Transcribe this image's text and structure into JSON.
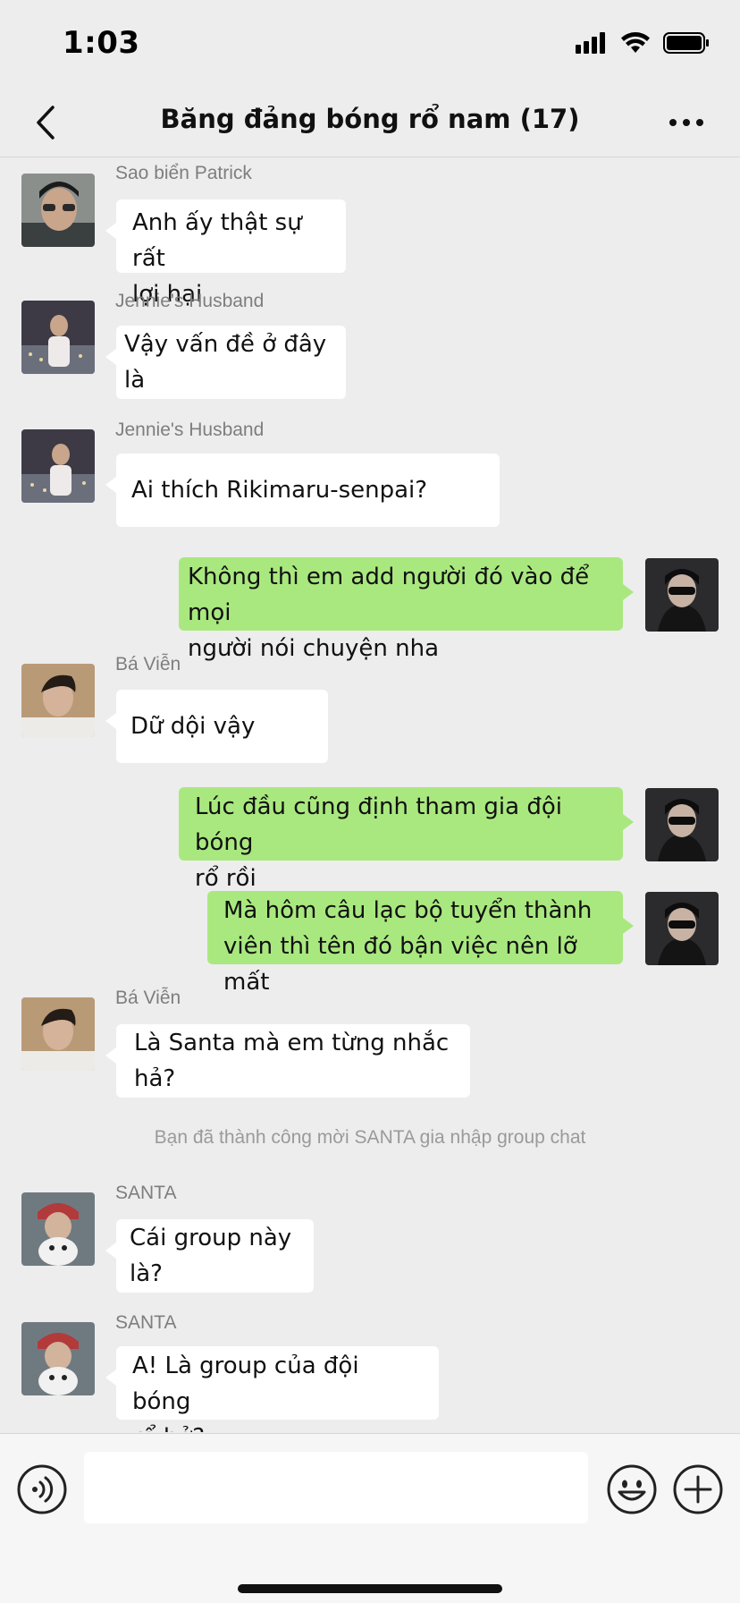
{
  "status_bar": {
    "time": "1:03",
    "signal_icon": "signal-bars-icon",
    "wifi_icon": "wifi-icon",
    "battery_icon": "battery-icon"
  },
  "nav": {
    "title": "Băng đảng bóng rổ nam (17)",
    "back_icon": "chevron-left-icon",
    "more_icon": "ellipsis-icon"
  },
  "messages": [
    {
      "sender": "Sao biển Patrick",
      "line1": "Anh ấy thật sự rất",
      "line2": "lợi hại"
    },
    {
      "sender": "Jennie's Husband",
      "line1": "Vậy vấn đề ở đây là"
    },
    {
      "sender": "Jennie's Husband",
      "line1": "Ai thích Rikimaru-senpai?"
    },
    {
      "line1": "Không thì em add người đó vào để mọi",
      "line2": "người nói chuyện nha"
    },
    {
      "sender": "Bá Viễn",
      "line1": "Dữ dội vậy"
    },
    {
      "line1": "Lúc đầu cũng định tham gia đội bóng",
      "line2": "rổ rồi"
    },
    {
      "line1": "Mà hôm câu lạc bộ tuyển thành",
      "line2": "viên thì tên đó bận việc nên lỡ mất"
    },
    {
      "sender": "Bá Viễn",
      "line1": "Là Santa mà em từng nhắc hả?"
    },
    {
      "sender": "SANTA",
      "line1": "Cái group này là?"
    },
    {
      "sender": "SANTA",
      "line1": "A! Là group của đội bóng",
      "line2": "rổ hở?"
    }
  ],
  "system_message": "Bạn đã thành công mời SANTA gia nhập group chat",
  "input": {
    "value": "",
    "voice_icon": "voice-icon",
    "emoji_icon": "emoji-icon",
    "plus_icon": "plus-icon"
  },
  "colors": {
    "background": "#ededed",
    "incoming_bubble": "#ffffff",
    "outgoing_bubble": "#a9e87f"
  }
}
